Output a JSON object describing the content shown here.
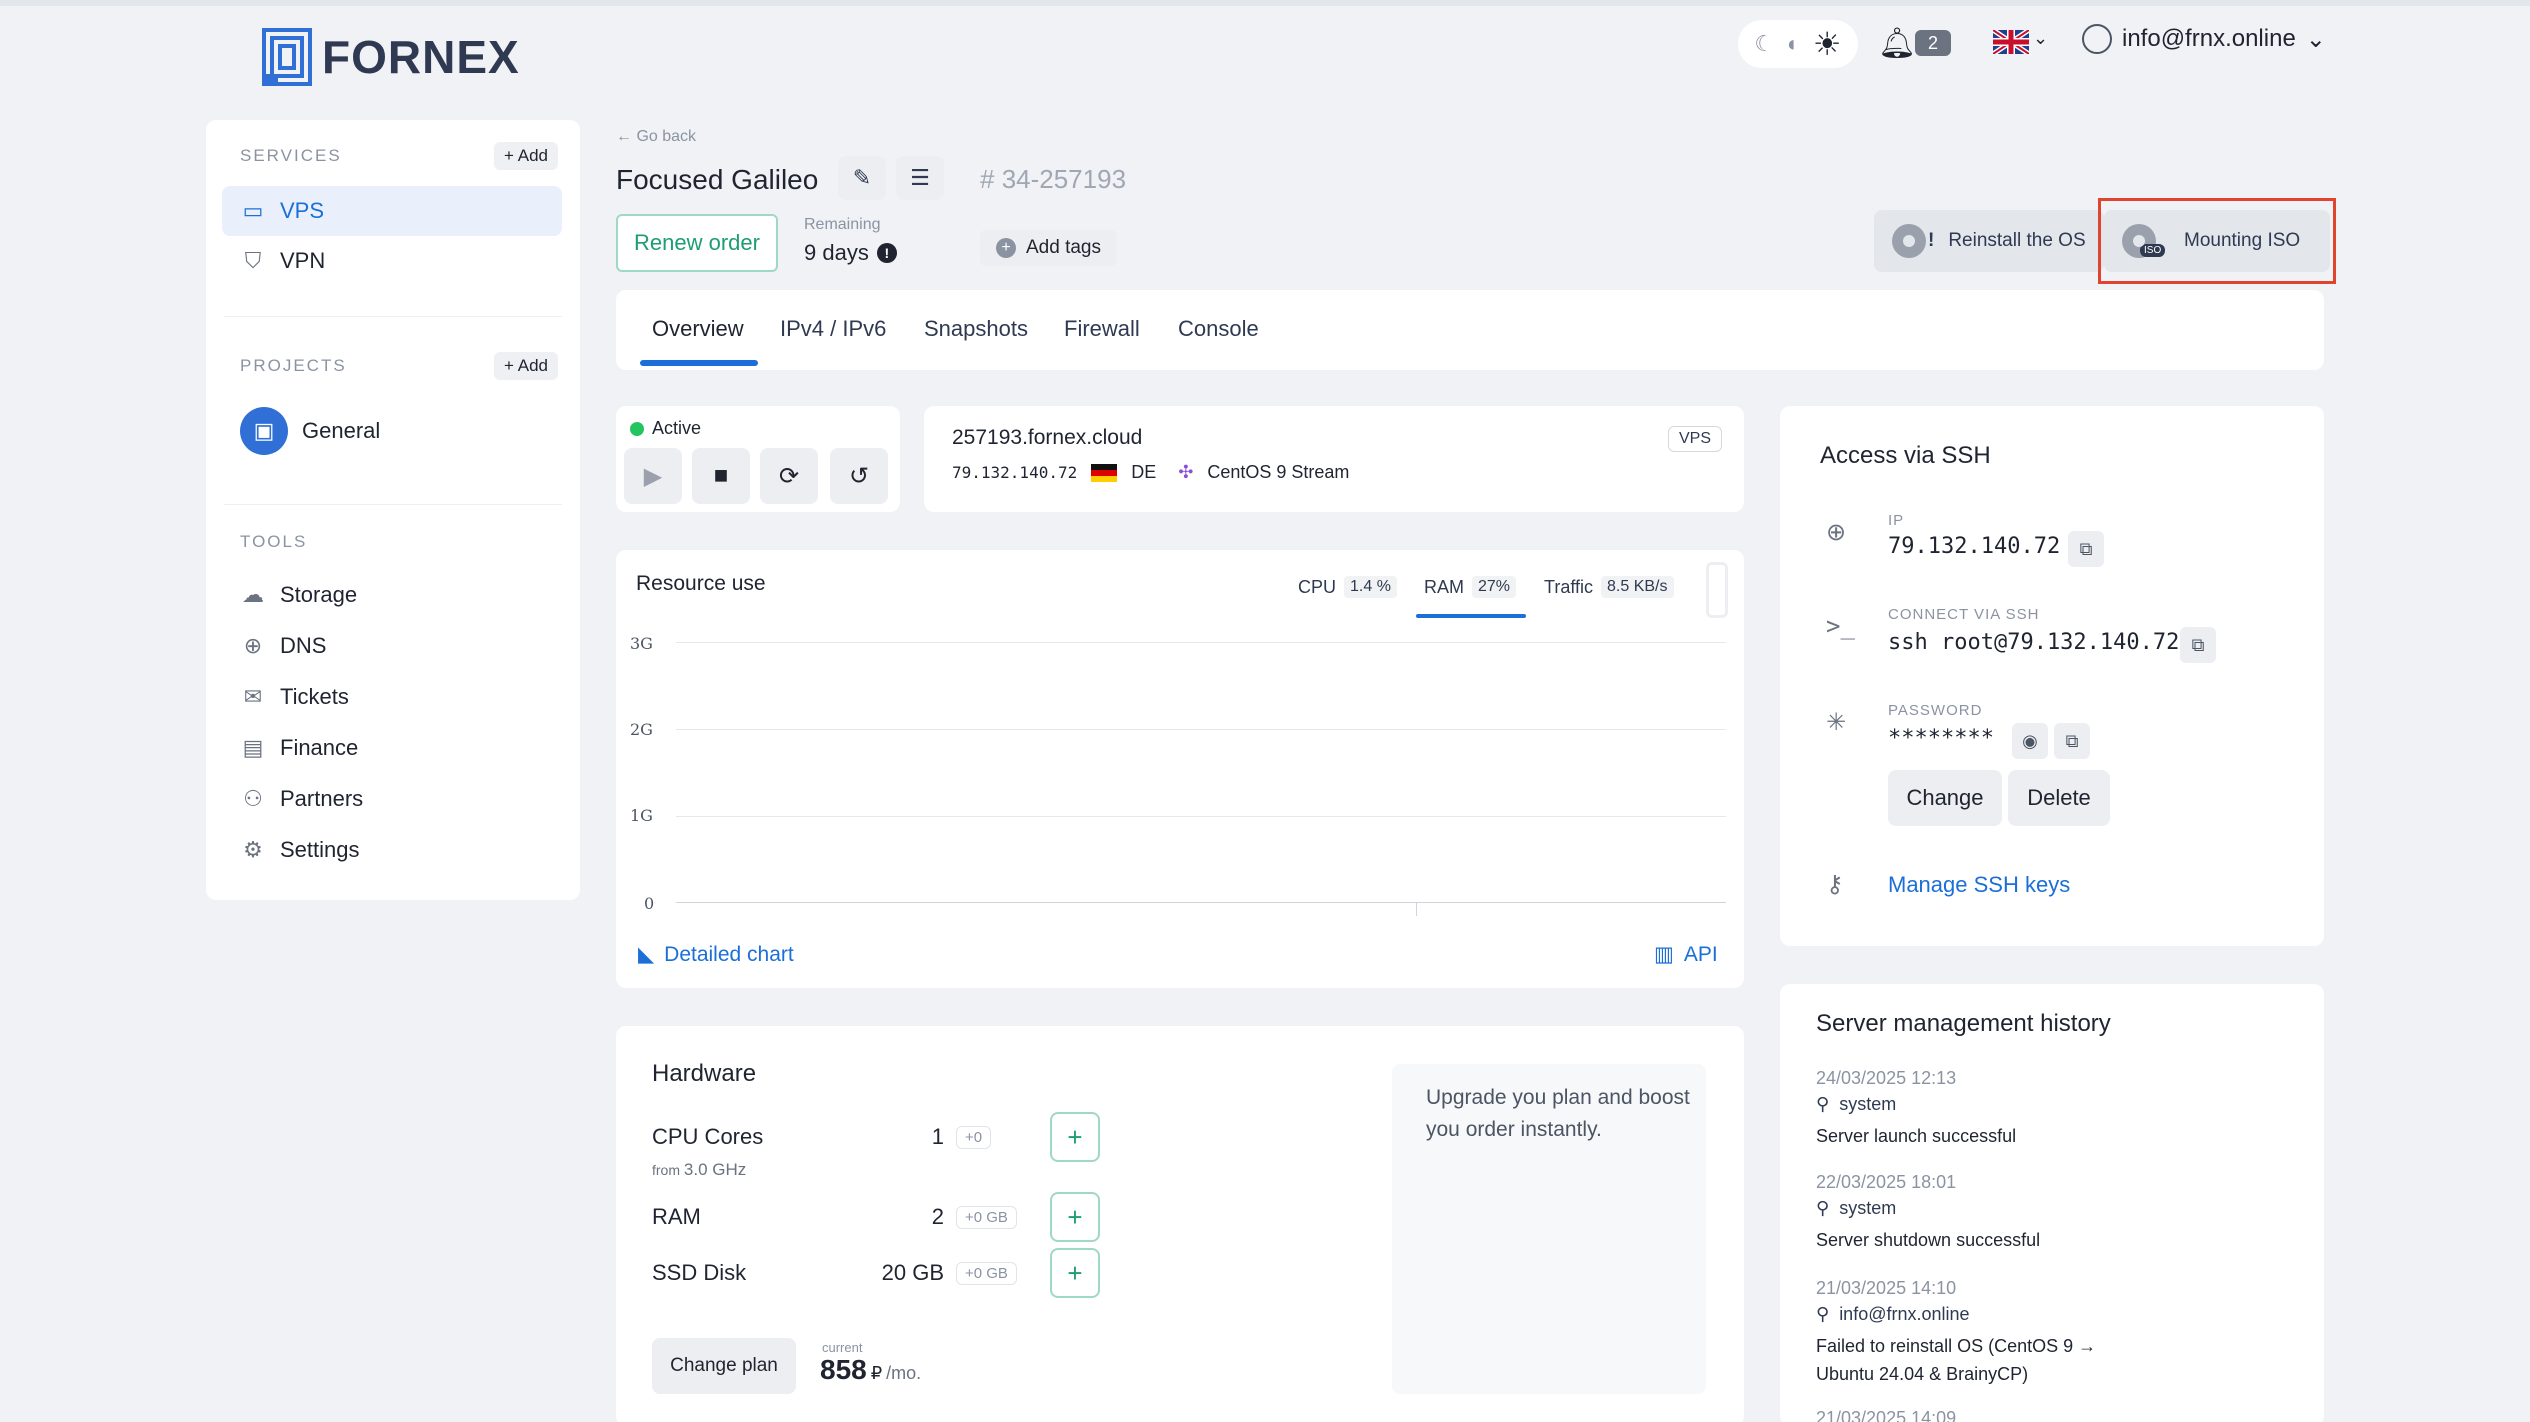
{
  "brand": {
    "name": "FORNEX"
  },
  "header": {
    "notifications_count": "2",
    "user_email": "info@frnx.online"
  },
  "sidebar": {
    "services_title": "SERVICES",
    "services_add": "+ Add",
    "services": [
      {
        "label": "VPS",
        "icon": "server-icon",
        "active": true
      },
      {
        "label": "VPN",
        "icon": "shield-icon",
        "active": false
      }
    ],
    "projects_title": "PROJECTS",
    "projects_add": "Add",
    "projects": [
      {
        "label": "General"
      }
    ],
    "tools_title": "TOOLS",
    "tools": [
      {
        "label": "Storage",
        "icon": "cloud-icon"
      },
      {
        "label": "DNS",
        "icon": "globe-icon"
      },
      {
        "label": "Tickets",
        "icon": "chat-icon"
      },
      {
        "label": "Finance",
        "icon": "card-icon"
      },
      {
        "label": "Partners",
        "icon": "users-icon"
      },
      {
        "label": "Settings",
        "icon": "gear-icon"
      }
    ]
  },
  "server": {
    "go_back": "Go back",
    "name": "Focused Galileo",
    "order_number": "34-257193",
    "renew_label": "Renew order",
    "remaining_label": "Remaining",
    "remaining_value": "9 days",
    "add_tags_label": "Add tags",
    "reinstall_label": "Reinstall the OS",
    "mount_iso_label": "Mounting ISO",
    "iso_badge": "ISO"
  },
  "tabs": [
    "Overview",
    "IPv4 / IPv6",
    "Snapshots",
    "Firewall",
    "Console"
  ],
  "status": {
    "label": "Active"
  },
  "host": {
    "hostname": "257193.fornex.cloud",
    "ip": "79.132.140.72",
    "country": "DE",
    "os": "CentOS 9 Stream",
    "badge": "VPS"
  },
  "resource": {
    "title": "Resource use",
    "tabs": [
      {
        "label": "CPU",
        "value": "1.4 %"
      },
      {
        "label": "RAM",
        "value": "27%"
      },
      {
        "label": "Traffic",
        "value": "8.5 KB/s"
      }
    ],
    "y_labels": [
      "3G",
      "2G",
      "1G",
      "0"
    ],
    "detailed_chart": "Detailed chart",
    "api": "API"
  },
  "ssh": {
    "title": "Access via SSH",
    "ip_label": "IP",
    "ip_value": "79.132.140.72",
    "connect_label": "CONNECT VIA SSH",
    "connect_value": "ssh root@79.132.140.72",
    "password_label": "PASSWORD",
    "password_value": "********",
    "change_label": "Change",
    "delete_label": "Delete",
    "manage_keys": "Manage SSH keys"
  },
  "hardware": {
    "title": "Hardware",
    "cpu_label": "CPU Cores",
    "cpu_value": "1",
    "cpu_delta": "+0",
    "cpu_from": "from",
    "cpu_freq": "3.0 GHz",
    "ram_label": "RAM",
    "ram_value": "2",
    "ram_delta": "+0 GB",
    "disk_label": "SSD Disk",
    "disk_value": "20 GB",
    "disk_delta": "+0 GB",
    "upgrade_text": "Upgrade you plan and boost you order instantly.",
    "change_plan": "Change plan",
    "current_label": "current",
    "price": "858",
    "currency": "₽",
    "period": "/mo."
  },
  "history": {
    "title": "Server management history",
    "entries": [
      {
        "date": "24/03/2025 12:13",
        "user": "system",
        "message": "Server launch successful"
      },
      {
        "date": "22/03/2025 18:01",
        "user": "system",
        "message": "Server shutdown successful"
      },
      {
        "date": "21/03/2025 14:10",
        "user": "info@frnx.online",
        "message": "Failed to reinstall OS (CentOS 9 → Ubuntu 24.04 & BrainyCP)"
      },
      {
        "date": "21/03/2025 14:09",
        "user": "",
        "message": ""
      }
    ]
  }
}
